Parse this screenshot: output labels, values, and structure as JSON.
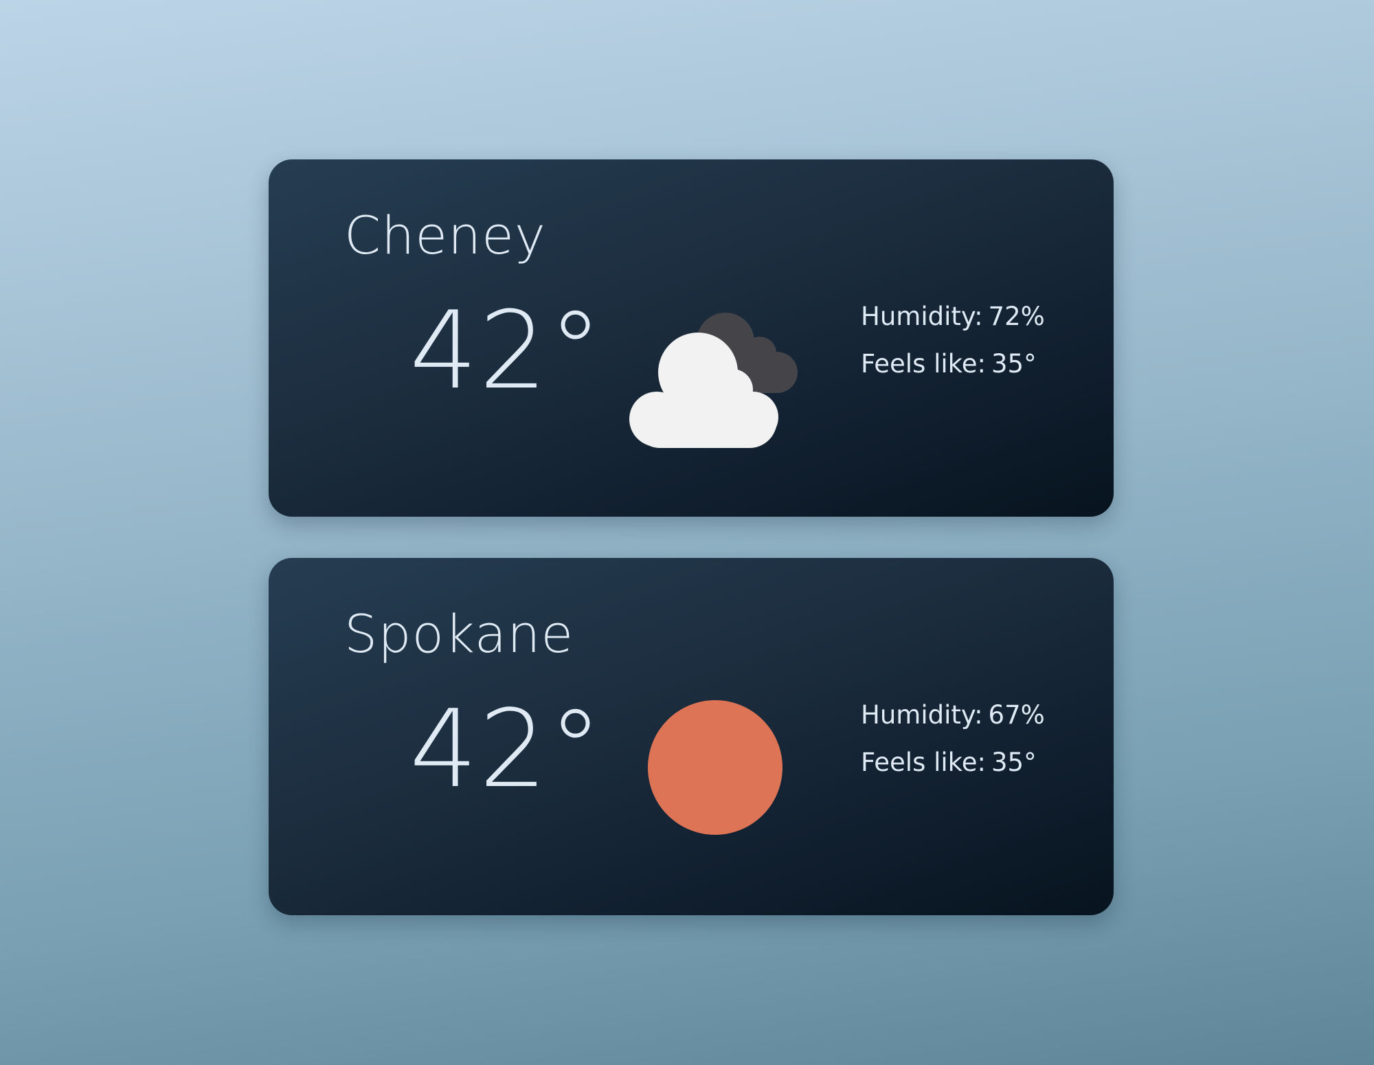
{
  "cards": [
    {
      "city": "Cheney",
      "temperature": "42°",
      "icon": "partly-cloudy-icon",
      "humidity_label": "Humidity:",
      "humidity_value": "72%",
      "feels_label": "Feels like:",
      "feels_value": "35°"
    },
    {
      "city": "Spokane",
      "temperature": "42°",
      "icon": "sun-icon",
      "humidity_label": "Humidity:",
      "humidity_value": "67%",
      "feels_label": "Feels like:",
      "feels_value": "35°"
    }
  ],
  "colors": {
    "sun": "#dd7455",
    "cloud_front": "#f2f2f2",
    "cloud_back": "#454549",
    "card_text": "#dfeaf4"
  }
}
